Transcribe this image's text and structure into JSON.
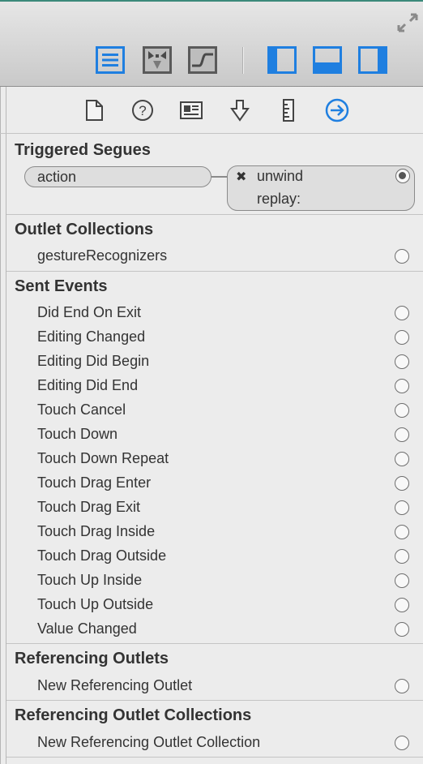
{
  "toolbar": {
    "fullscreen_icon": "fullscreen-toggle-icon",
    "editor_buttons": [
      {
        "name": "standard-editor-icon",
        "active": true
      },
      {
        "name": "assistant-editor-icon",
        "active": false
      },
      {
        "name": "version-editor-icon",
        "active": false
      }
    ],
    "view_buttons": [
      {
        "name": "navigator-toggle-icon",
        "active": true
      },
      {
        "name": "debug-area-toggle-icon",
        "active": true
      },
      {
        "name": "utilities-toggle-icon",
        "active": true
      }
    ],
    "accent_color": "#1f7fe0"
  },
  "inspector_tabs": [
    {
      "name": "file-inspector-icon",
      "active": false
    },
    {
      "name": "quick-help-icon",
      "active": false
    },
    {
      "name": "identity-inspector-icon",
      "active": false
    },
    {
      "name": "attributes-inspector-icon",
      "active": false
    },
    {
      "name": "size-inspector-icon",
      "active": false
    },
    {
      "name": "connections-inspector-icon",
      "active": true
    }
  ],
  "triggered_segues": {
    "title": "Triggered Segues",
    "action_label": "action",
    "target_remove_glyph": "✖",
    "target_line1": "unwind",
    "target_line2": "replay:"
  },
  "outlet_collections": {
    "title": "Outlet Collections",
    "items": [
      "gestureRecognizers"
    ]
  },
  "sent_events": {
    "title": "Sent Events",
    "items": [
      "Did End On Exit",
      "Editing Changed",
      "Editing Did Begin",
      "Editing Did End",
      "Touch Cancel",
      "Touch Down",
      "Touch Down Repeat",
      "Touch Drag Enter",
      "Touch Drag Exit",
      "Touch Drag Inside",
      "Touch Drag Outside",
      "Touch Up Inside",
      "Touch Up Outside",
      "Value Changed"
    ]
  },
  "referencing_outlets": {
    "title": "Referencing Outlets",
    "items": [
      "New Referencing Outlet"
    ]
  },
  "referencing_outlet_collections": {
    "title": "Referencing Outlet Collections",
    "items": [
      "New Referencing Outlet Collection"
    ]
  }
}
